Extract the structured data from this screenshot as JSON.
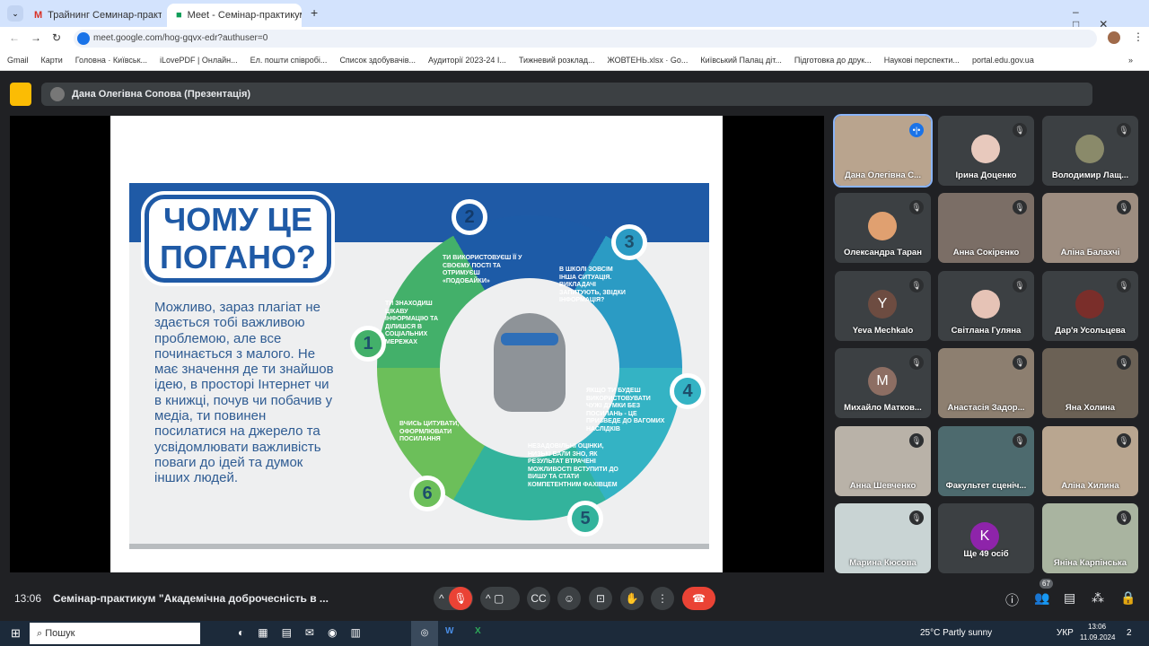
{
  "browser": {
    "tabs": [
      {
        "label": "Трайнинг Семинар-практикум"
      },
      {
        "label": "Meet - Семінар-практикум"
      }
    ],
    "url": "meet.google.com/hog-gqvx-edr?authuser=0",
    "new_tab": "+",
    "bookmarks": [
      "Gmail",
      "Карти",
      "Головна · Київськ...",
      "iLovePDF | Онлайн...",
      "Ел. пошти співробі...",
      "Список здобувачів...",
      "Аудиторії 2023-24 І...",
      "Тижневий розклад...",
      "ЖОВТЕНЬ.xlsx · Go...",
      "Київський Палац діт...",
      "Підготовка до друк...",
      "Наукові перспекти...",
      "portal.edu.gov.ua"
    ],
    "more": "»"
  },
  "meet": {
    "presenter": "Дана Олегівна Сопова (Презентація)",
    "time": "13:06",
    "meeting_title": "Семінар-практикум \"Академічна доброчесність в ...",
    "participants_count": "67",
    "tiles": [
      {
        "name": "Дана Олегівна С...",
        "bg": "#b9a48e",
        "active": true
      },
      {
        "name": "Ірина Доценко",
        "avatar": "",
        "bg": "#3c4043",
        "pic": "#e8c9bd"
      },
      {
        "name": "Володимир Лащ...",
        "bg": "#3c4043",
        "pic": "#8a8a6a"
      },
      {
        "name": "Олександра Таран",
        "bg": "#3c4043",
        "pic": "#e0a070"
      },
      {
        "name": "Анна Сокіренко",
        "bg": "#7b6e66"
      },
      {
        "name": "Аліна Балахчі",
        "bg": "#9d8d80"
      },
      {
        "name": "Yeva Mechkalo",
        "letter": "Y",
        "bg": "#3c4043",
        "pic": "#6d4c41"
      },
      {
        "name": "Світлана Гуляна",
        "bg": "#3c4043",
        "pic": "#e6c3b6"
      },
      {
        "name": "Дар'я Усольцева",
        "bg": "#3c4043",
        "pic": "#7a2e2a"
      },
      {
        "name": "Михайло Матков...",
        "letter": "M",
        "bg": "#3c4043",
        "pic": "#8d6e63"
      },
      {
        "name": "Анастасія Задор...",
        "bg": "#8d7f70"
      },
      {
        "name": "Яна Холина",
        "bg": "#6b6155"
      },
      {
        "name": "Анна Шевченко",
        "bg": "#b9b2a8"
      },
      {
        "name": "Факультет сценіч...",
        "bg": "#4d6a6e"
      },
      {
        "name": "Аліна Хилина",
        "bg": "#b9a690"
      },
      {
        "name": "Марина Кюсова",
        "bg": "#c9d4d4"
      },
      {
        "name": "Ще 49 осіб",
        "letter": "K",
        "bg": "#3c4043",
        "pic": "#8e24aa",
        "more": true
      },
      {
        "name": "Яніна Карпінська",
        "bg": "#a9b4a0"
      }
    ]
  },
  "slide": {
    "title_line1": "ЧОМУ ЦЕ",
    "title_line2": "ПОГАНО?",
    "body": "Можливо, зараз плагіат не здається тобі важливою проблемою, але все починається з малого. Не має значення де ти знайшов ідею, в просторі Інтернет чи в книжці, почув чи побачив у медіа, ти повинен посилатися на джерело та усвідомлювати важливість поваги до ідей та думок інших людей.",
    "steps": [
      {
        "n": "1",
        "text": "Ти знаходиш цікаву інформацію та ділишся в соціальних мережах"
      },
      {
        "n": "2",
        "text": "Ти використовуєш її у своєму пості та отримуєш «подобайки»"
      },
      {
        "n": "3",
        "text": "В школі зовсім інша ситуація. Викладачі запитують, звідки інформація?"
      },
      {
        "n": "4",
        "text": "Якщо ти будеш використовувати чужі думки без посилань - це призведе до вагомих наслідків"
      },
      {
        "n": "5",
        "text": "Незадовільні оцінки, низькі бали ЗНО, як результат втрачені можливості вступити до вишу та стати компетентним фахівцем"
      },
      {
        "n": "6",
        "text": "Вчись цитувати, оформлювати посилання"
      }
    ]
  },
  "taskbar": {
    "search": "Пошук",
    "weather": "25°C  Partly sunny",
    "lang": "УКР",
    "time": "13:06",
    "date": "11.09.2024",
    "notif": "2"
  }
}
